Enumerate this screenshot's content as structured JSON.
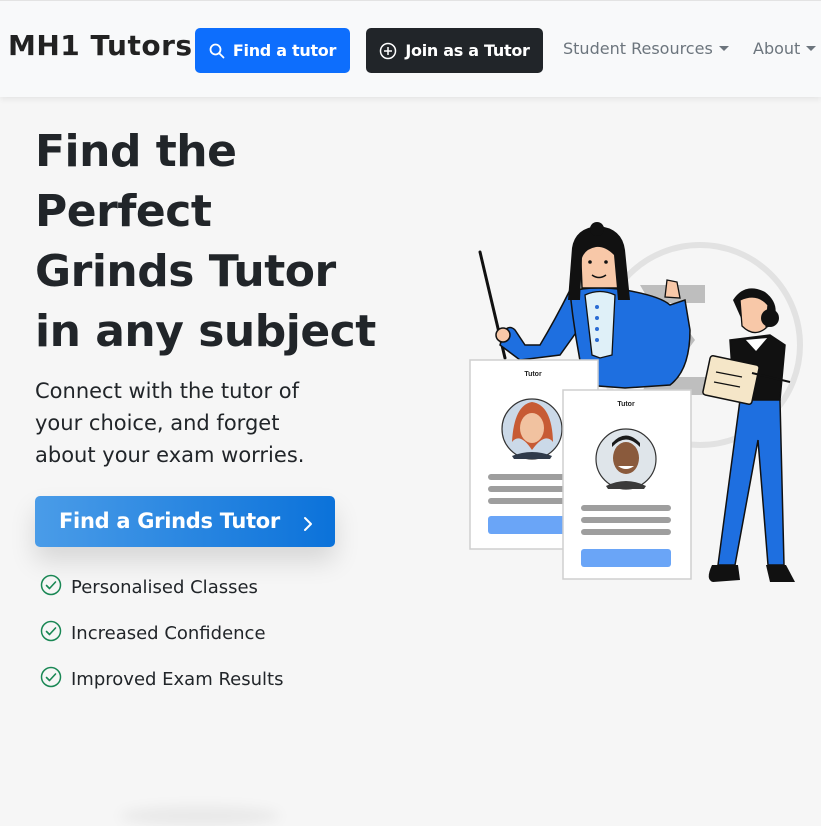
{
  "nav": {
    "brand": "MH1 Tutors",
    "find_tutor_label": "Find a tutor",
    "join_label": "Join as a Tutor",
    "links": [
      {
        "label": "Student Resources"
      },
      {
        "label": "About"
      }
    ]
  },
  "hero": {
    "title_lines": [
      "Find the",
      "Perfect",
      "Grinds Tutor",
      "in any subject"
    ],
    "subtitle_lines": [
      "Connect with the tutor of",
      "your choice, and forget",
      "about your exam worries."
    ],
    "cta_label": "Find a Grinds Tutor",
    "benefits": [
      {
        "label": "Personalised Classes"
      },
      {
        "label": "Increased Confidence"
      },
      {
        "label": "Improved Exam Results"
      }
    ]
  },
  "illustration": {
    "card_label": "Tutor",
    "colors": {
      "accent": "#1e6fe0",
      "button_blue": "#6aa5f7"
    }
  }
}
